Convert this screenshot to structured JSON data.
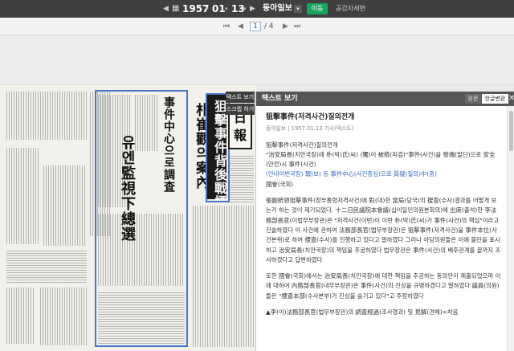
{
  "toolbar": {
    "prev_arrow": "◀",
    "next_arrow": "▶",
    "year": "1957",
    "month": "01",
    "day": "13",
    "newspaper": "동아일보",
    "newspaper_caret": "▾",
    "move_label": "이동",
    "publication_link": "공감자세현",
    "date_caret": "▾"
  },
  "pager": {
    "first": "⏮",
    "prev": "◀",
    "current_page": "1",
    "total": "/ 4",
    "next": "▶",
    "last": "⏭"
  },
  "paper": {
    "masthead_1": "日",
    "masthead_2": "報",
    "headline_1": "狙擊事件背後戰慄",
    "headline_2": "朴崔觀의案內",
    "headline_3": "事件中心으로調査",
    "headline_4": "유엔監視下總選",
    "text_view_tab": "텍스트 보기",
    "scrap_tab": "스크랩 하기"
  },
  "text_panel": {
    "title": "텍스트 보기",
    "original_label": "원문",
    "translate_label": "한글변환",
    "close": "✕",
    "article_title": "狙擊事件(저격사건)질의전개",
    "article_meta": "동아일보 | 1957.01.13 기사(텍스트)",
    "p1_a": "狙擊事件(저격사건)질의전개",
    "p1_b": "\"治安局長(치안국장)에 朴(박)氏(씨) (獨)이 被檢(피검)\"事件(사건)을 發端(발단)으로 安全(안전)시 事件(사건)",
    "p1_c": "(안내이번국장) 報(보) 등 事件中心(사건중심)으로 質疑(질의)中(중)",
    "p1_d": "國會(국회)",
    "p2": "張副統領狙擊事件(장부통령저격사건)에 對(대)한 當局(당국)의 搜查(수사)결과를 어떻게 보는가 하는 것이 제기되었다. 十二日民議院本會議(십이일민의원본회의)에 出席(출석)한 李法務部長官(이법무부장관)은 \"저격사건(이번)이 이란 朴(박)氏(씨)가 事件(사건)의 핵심\"이라고 진술하였다 이 사건에 관하여 法務部長官(법무부장관)은 狙擊事件(저격사건)을 事件本位(사건본위)로 하여 捜査(수사)를 진행하고 있다고 말하였다 그러나 야당의원들은 이에 불만을 표시하고 治安局長(치안국장)의 책임을 추궁하였다 법무장관은 事件(사건)의 배후관계를 끝까지 조사하겠다고 답변하였다",
    "p3": "또한 國會(국회)에서는 治安局長(치안국장)에 대한 책임을 추궁하는 동의안이 제출되었으며 이에 대하여 內務部長官(내무부장관)은 事件(사건)의 진상을 규명하겠다고 말하였다 議員(의원)들은 \"捜査本部(수사본부)가 진상을 숨기고 있다\"고 주장하였다",
    "p4": "▲李(이)法務部長官(법무부장관)의 調査經過(조사경과) 및 見解(견해)=차음 "
  }
}
